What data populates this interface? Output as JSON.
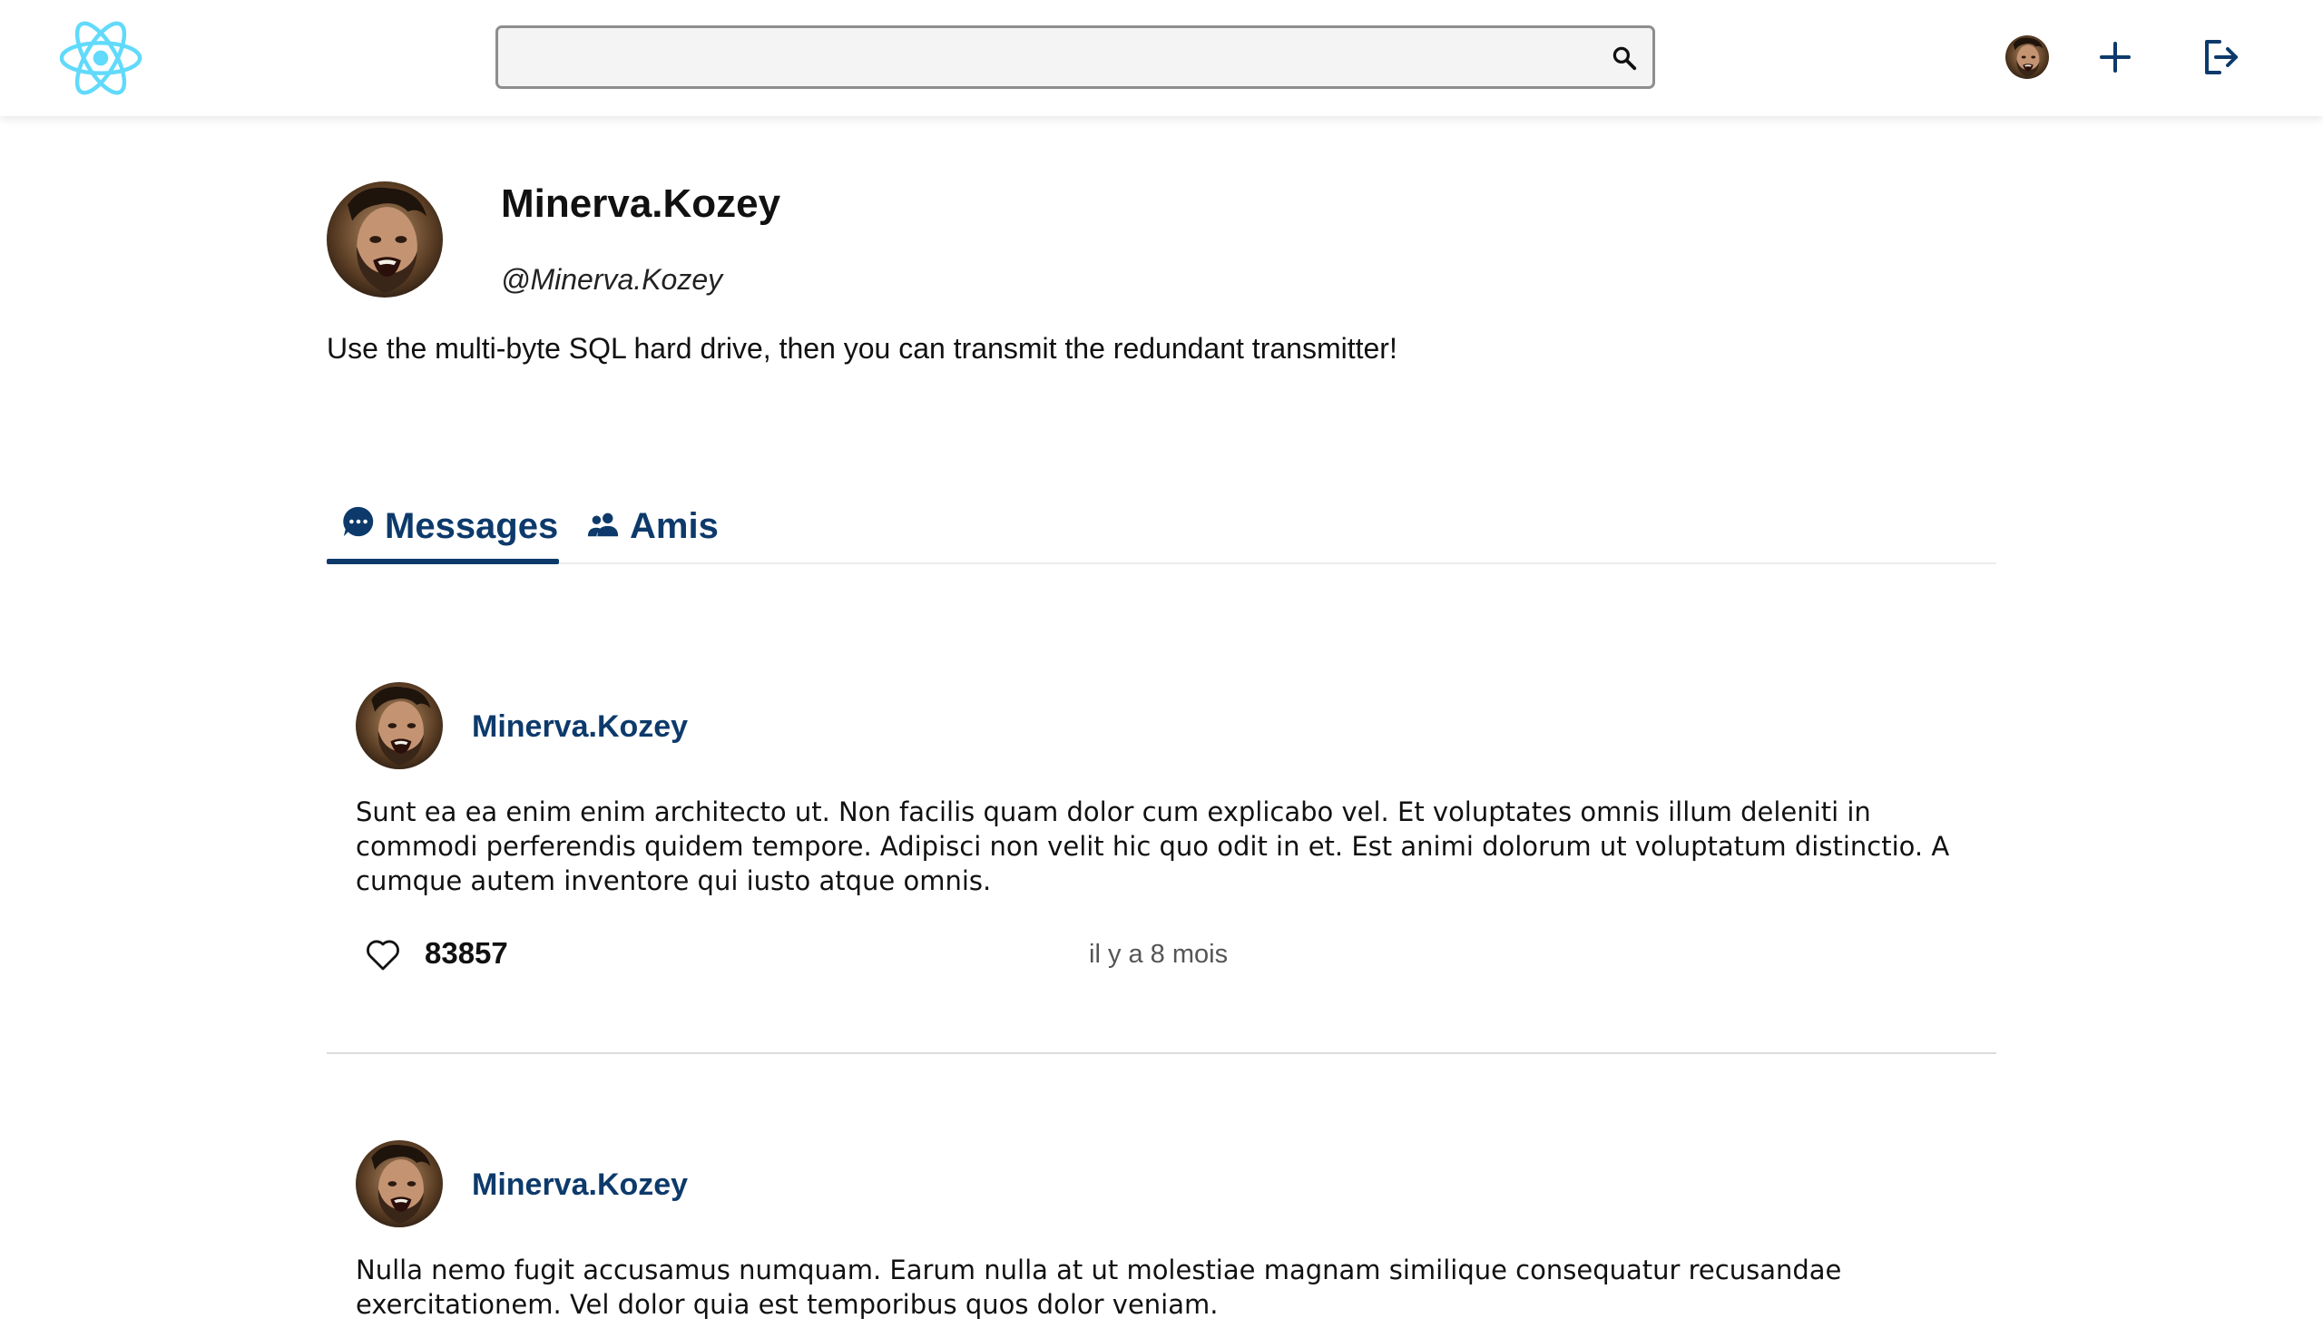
{
  "search": {
    "placeholder": "",
    "value": ""
  },
  "profile": {
    "name": "Minerva.Kozey",
    "handle": "@Minerva.Kozey",
    "bio": "Use the multi-byte SQL hard drive, then you can transmit the redundant transmitter!"
  },
  "tabs": [
    {
      "label": "Messages",
      "icon": "chat-bubble-icon",
      "active": true
    },
    {
      "label": "Amis",
      "icon": "people-icon",
      "active": false
    }
  ],
  "posts": [
    {
      "author": "Minerva.Kozey",
      "body": "Sunt ea ea enim enim architecto ut. Non facilis quam dolor cum explicabo vel. Et voluptates omnis illum deleniti in commodi perferendis quidem tempore. Adipisci non velit hic quo odit in et. Est animi dolorum ut voluptatum distinctio. A cumque autem inventore qui iusto atque omnis.",
      "likes": "83857",
      "time": "il y a 8 mois"
    },
    {
      "author": "Minerva.Kozey",
      "body": "Nulla nemo fugit accusamus numquam. Earum nulla at ut molestiae magnam similique consequatur recusandae exercitationem. Vel dolor quia est temporibus quos dolor veniam."
    }
  ],
  "colors": {
    "accent": "#0d3a6b",
    "logo": "#61dafb",
    "divider": "#dcdcdc"
  },
  "icons": {
    "logo": "react-atom-logo",
    "search": "search-icon",
    "add": "plus-icon",
    "logout": "logout-icon",
    "like": "heart-outline-icon"
  }
}
